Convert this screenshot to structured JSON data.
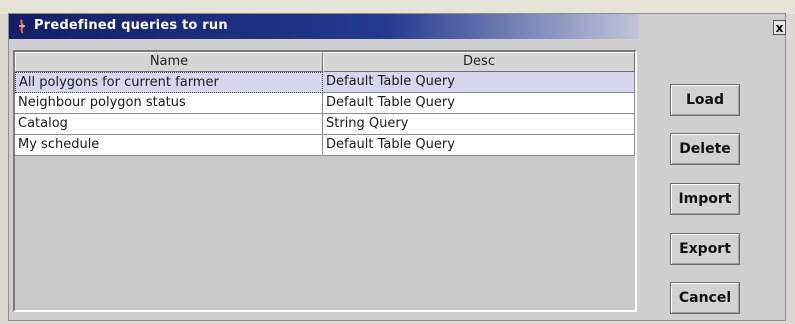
{
  "window": {
    "title": "Predefined queries to run",
    "close_glyph": "x"
  },
  "table": {
    "columns": [
      "Name",
      "Desc"
    ],
    "rows": [
      {
        "name": "All polygons for current farmer",
        "desc": "Default Table Query",
        "selected": true
      },
      {
        "name": "Neighbour polygon status",
        "desc": "Default Table Query",
        "selected": false
      },
      {
        "name": "Catalog",
        "desc": "String Query",
        "selected": false
      },
      {
        "name": "My schedule",
        "desc": "Default Table Query",
        "selected": false
      }
    ]
  },
  "buttons": {
    "load": "Load",
    "delete": "Delete",
    "import": "Import",
    "export": "Export",
    "cancel": "Cancel"
  },
  "colors": {
    "titlebar_start": "#111f68",
    "selected_row": "#d8d6ee"
  },
  "icons": {
    "title_icon": "app-icon",
    "close_icon": "close-icon"
  }
}
